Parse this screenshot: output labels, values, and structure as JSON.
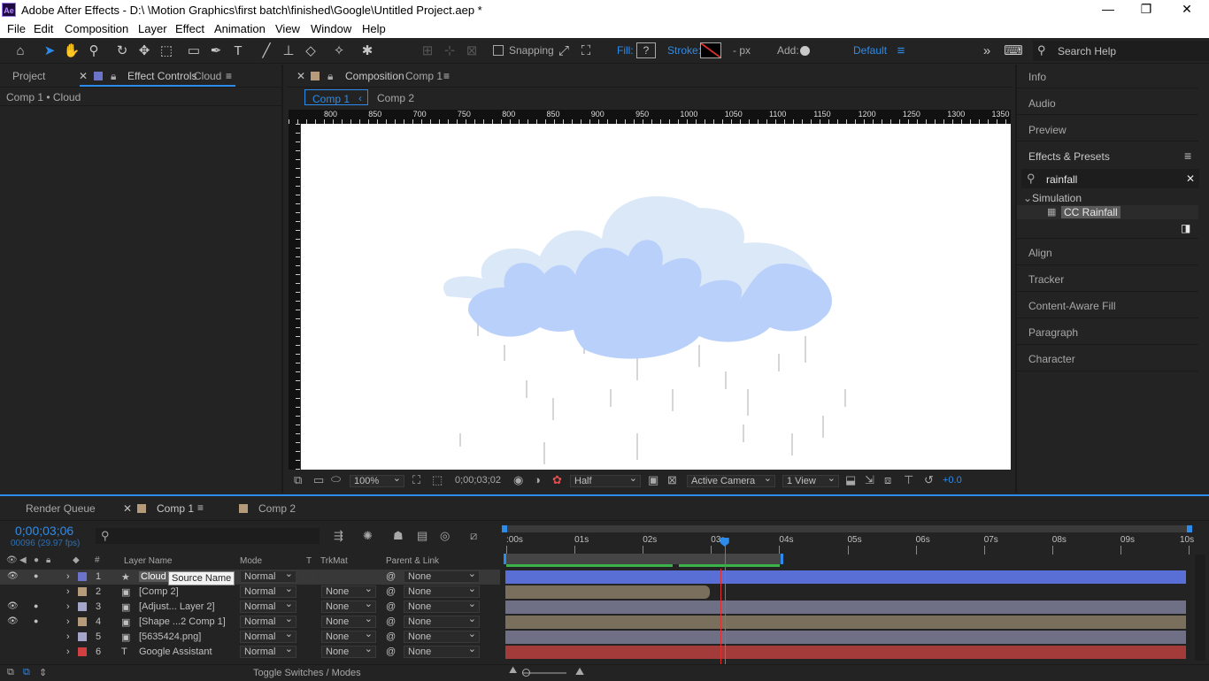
{
  "titlebar": {
    "logo": "Ae",
    "title": "Adobe After Effects - D:\\ \\Motion Graphics\\first batch\\finished\\Google\\Untitled Project.aep *",
    "min": "—",
    "max": "❐",
    "close": "✕"
  },
  "menu": [
    "File",
    "Edit",
    "Composition",
    "Layer",
    "Effect",
    "Animation",
    "View",
    "Window",
    "Help"
  ],
  "toolbar": {
    "snapping": "Snapping",
    "fill": "Fill:",
    "fill_value": "?",
    "stroke": "Stroke:",
    "stroke_unit": "- px",
    "add": "Add:",
    "workspace": "Default",
    "search_help": "Search Help"
  },
  "left": {
    "tab_project": "Project",
    "tab_effect": "Effect Controls",
    "tab_effect_layer": "Cloud",
    "breadcrumb": "Comp 1 • Cloud"
  },
  "comp": {
    "tab_label": "Composition",
    "tab_name": "Comp 1",
    "sub_tab1": "Comp 1",
    "sub_tab2": "Comp 2",
    "ruler": [
      "800",
      "850",
      "700",
      "750",
      "800",
      "850",
      "900",
      "950",
      "1000",
      "1050",
      "1100",
      "1150",
      "1200",
      "1250",
      "1300",
      "1350"
    ],
    "zoom": "100%",
    "timecode": "0;00;03;02",
    "resolution": "Half",
    "camera": "Active Camera",
    "views": "1 View",
    "exposure": "+0.0"
  },
  "right": {
    "info": "Info",
    "audio": "Audio",
    "preview": "Preview",
    "effects": "Effects & Presets",
    "search_value": "rainfall",
    "category": "Simulation",
    "effect_item": "CC Rainfall",
    "align": "Align",
    "tracker": "Tracker",
    "content_aware": "Content-Aware Fill",
    "paragraph": "Paragraph",
    "character": "Character"
  },
  "timeline": {
    "tab_render": "Render Queue",
    "tab_comp1": "Comp 1",
    "tab_comp2": "Comp 2",
    "timecode": "0;00;03;06",
    "fps": "00096 (29.97 fps)",
    "col_layer": "Layer Name",
    "col_mode": "Mode",
    "col_t": "T",
    "col_trkmat": "TrkMat",
    "col_parent": "Parent & Link",
    "tooltip": "Source Name",
    "time_labels": [
      ":00s",
      "01s",
      "02s",
      "03s",
      "04s",
      "05s",
      "06s",
      "07s",
      "08s",
      "09s",
      "10s"
    ],
    "playhead_fraction": 0.32,
    "layers": [
      {
        "num": "1",
        "name": "Cloud",
        "mode": "Normal",
        "trkmat": "",
        "parent": "None",
        "color": "#6b74c9",
        "bar": "#5a6fd6"
      },
      {
        "num": "2",
        "name": "[Comp 2]",
        "mode": "Normal",
        "trkmat": "None",
        "parent": "None",
        "color": "#b59b7a",
        "bar": "#7a6e5c"
      },
      {
        "num": "3",
        "name": "[Adjust... Layer 2]",
        "mode": "Normal",
        "trkmat": "None",
        "parent": "None",
        "color": "#a5a5cc",
        "bar": "#6f6f86"
      },
      {
        "num": "4",
        "name": "[Shape ...2 Comp 1]",
        "mode": "Normal",
        "trkmat": "None",
        "parent": "None",
        "color": "#b59b7a",
        "bar": "#7a6e5c"
      },
      {
        "num": "5",
        "name": "[5635424.png]",
        "mode": "Normal",
        "trkmat": "None",
        "parent": "None",
        "color": "#a5a5cc",
        "bar": "#6f6f86"
      },
      {
        "num": "6",
        "name": "Google Assistant",
        "mode": "Normal",
        "trkmat": "None",
        "parent": "None",
        "color": "#d04040",
        "bar": "#a33b3b"
      }
    ],
    "footer": "Toggle Switches / Modes"
  }
}
